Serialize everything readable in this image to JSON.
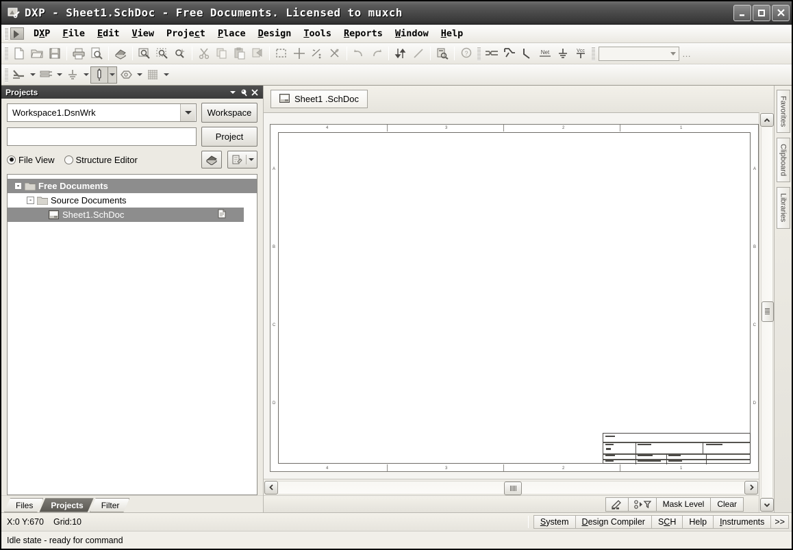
{
  "window": {
    "title": "DXP - Sheet1.SchDoc - Free Documents. Licensed to muxch",
    "minimize_label": "_",
    "maximize_label": "□",
    "close_label": "✕",
    "app_icon": "dxp-app-icon"
  },
  "menubar": {
    "items": [
      {
        "label": "DXP",
        "accel": "X"
      },
      {
        "label": "File",
        "accel": "F"
      },
      {
        "label": "Edit",
        "accel": "E"
      },
      {
        "label": "View",
        "accel": "V"
      },
      {
        "label": "Project",
        "accel": "c"
      },
      {
        "label": "Place",
        "accel": "P"
      },
      {
        "label": "Design",
        "accel": "D"
      },
      {
        "label": "Tools",
        "accel": "T"
      },
      {
        "label": "Reports",
        "accel": "R"
      },
      {
        "label": "Window",
        "accel": "W"
      },
      {
        "label": "Help",
        "accel": "H"
      }
    ]
  },
  "toolbar_main": {
    "combo_value": "",
    "overflow_label": "…",
    "icons": [
      "new-document-icon",
      "open-folder-icon",
      "save-icon",
      "print-icon",
      "print-preview-icon",
      "open-report-icon",
      "zoom-area-icon",
      "zoom-selection-icon",
      "zoom-filter-icon",
      "cut-icon",
      "copy-icon",
      "paste-icon",
      "rubber-stamp-icon",
      "select-area-icon",
      "move-icon",
      "deselect-icon",
      "clear-filter-icon",
      "undo-icon",
      "redo-icon",
      "hierarchy-updown-icon",
      "line-icon",
      "browse-library-icon",
      "help-pointer-icon",
      "place-bus-icon",
      "place-wire-icon",
      "place-bus-entry-icon",
      "place-net-label-icon",
      "place-gnd-icon",
      "place-vcc-icon"
    ]
  },
  "toolbar_wiring": {
    "icons": [
      "place-wire-drop-icon",
      "place-bus-drop-icon",
      "place-gnd-drop-icon",
      "place-part-icon",
      "place-port-icon",
      "grid-icon"
    ],
    "pressed_index": 3
  },
  "projects_panel": {
    "title": "Projects",
    "header_icons": [
      "chevron-down-icon",
      "pin-icon",
      "close-icon"
    ],
    "workspace_value": "Workspace1.DsnWrk",
    "workspace_button": "Workspace",
    "project_value": "",
    "project_button": "Project",
    "view_modes": [
      {
        "label": "File View",
        "selected": true
      },
      {
        "label": "Structure Editor",
        "selected": false
      }
    ],
    "tool_icons": [
      "compile-icon",
      "document-options-icon"
    ],
    "tree": [
      {
        "label": "Free Documents",
        "level": 0,
        "expander": "-",
        "icon": "folder-icon",
        "selected": true,
        "bold": true
      },
      {
        "label": "Source Documents",
        "level": 1,
        "expander": "-",
        "icon": "folder-icon",
        "selected": false,
        "bold": false
      },
      {
        "label": "Sheet1.SchDoc",
        "level": 2,
        "expander": "",
        "icon": "schematic-doc-icon",
        "selected": true,
        "bold": false,
        "right_icon": "page-icon"
      }
    ],
    "tabs": [
      {
        "label": "Files",
        "active": false
      },
      {
        "label": "Projects",
        "active": true
      },
      {
        "label": "Filter",
        "active": false
      }
    ]
  },
  "editor": {
    "document_tab": {
      "label": "Sheet1 .SchDoc",
      "icon": "schematic-doc-icon"
    },
    "sheet_zone_labels_top": [
      "4",
      "3",
      "2",
      "1"
    ],
    "sheet_zone_labels_bottom": [
      "4",
      "3",
      "2",
      "1"
    ],
    "sheet_zone_labels_left": [
      "A",
      "B",
      "C",
      "D"
    ],
    "sheet_zone_labels_right": [
      "A",
      "B",
      "C",
      "D"
    ]
  },
  "mask_bar": {
    "icons": [
      "clear-filter-pencil-icon",
      "mask-filter-icon"
    ],
    "buttons": [
      {
        "label": "Mask Level"
      },
      {
        "label": "Clear"
      }
    ]
  },
  "right_tabs": [
    {
      "label": "Favorites"
    },
    {
      "label": "Clipboard"
    },
    {
      "label": "Libraries"
    }
  ],
  "status_bar": {
    "coords": "X:0 Y:670",
    "grid": "Grid:10",
    "buttons": [
      {
        "label": "System",
        "accel": "S"
      },
      {
        "label": "Design Compiler",
        "accel": "D"
      },
      {
        "label": "SCH",
        "accel": "C"
      },
      {
        "label": "Help",
        "accel": ""
      },
      {
        "label": "Instruments",
        "accel": "I"
      },
      {
        "label": ">>",
        "accel": ""
      }
    ],
    "message": "Idle state - ready for command"
  },
  "scrollbars": {
    "vertical": {
      "up": "▲",
      "down": "▼",
      "thumb_position_pct": 48
    },
    "horizontal": {
      "left": "‹",
      "right": "›",
      "thumb_position_pct": 49
    }
  },
  "colors": {
    "titlebar": "#4a4a4a",
    "panel_header": "#3f3f3f",
    "selection": "#8d8d8d",
    "chrome": "#eceae3",
    "canvas_bg": "#f5f4f1"
  }
}
